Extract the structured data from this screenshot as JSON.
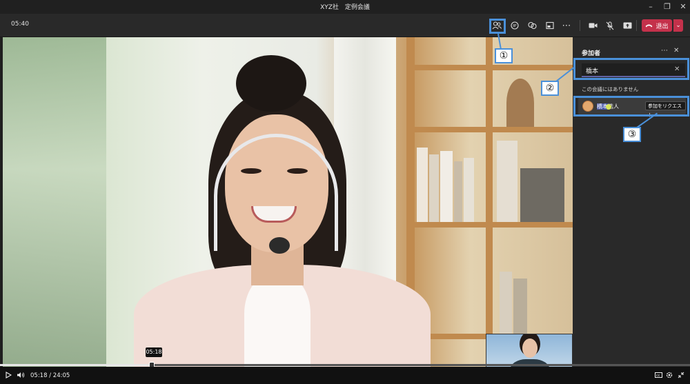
{
  "window": {
    "title": "XYZ社　定例会議",
    "controls": [
      "minimize-icon",
      "restore-icon",
      "close-icon"
    ]
  },
  "toolbar": {
    "elapsed_time": "05:40",
    "buttons": [
      "participants-icon",
      "chat-icon",
      "reactions-icon",
      "share-tray-icon",
      "more-icon",
      "camera-icon",
      "mic-muted-icon",
      "share-screen-icon"
    ],
    "leave_label": "退出"
  },
  "playback": {
    "current_time": "05:18",
    "separator": "/",
    "total_time": "24:05",
    "tooltip": "05:18",
    "progress_fraction": 0.22
  },
  "panel": {
    "title": "参加者",
    "search": {
      "value": "橋本"
    },
    "section_label": "この会議にはありません",
    "participant": {
      "name_highlight": "橋本",
      "name_rest": "浩人",
      "request_label": "参加をリクエスト"
    }
  },
  "callouts": [
    {
      "number": "①"
    },
    {
      "number": "②"
    },
    {
      "number": "③"
    }
  ],
  "colors": {
    "accent": "#4a90d9",
    "leave": "#c4314b",
    "search_underline": "#6264a7"
  }
}
